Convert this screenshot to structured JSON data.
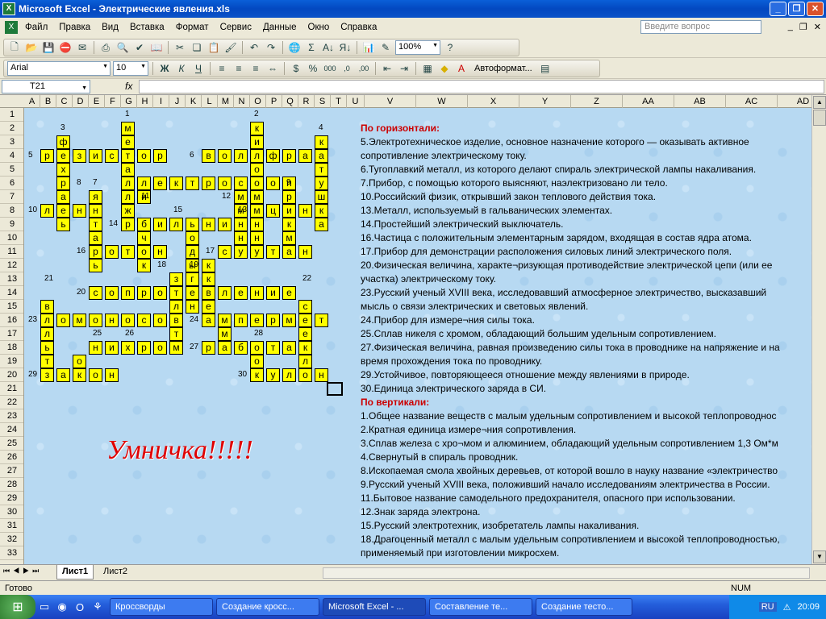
{
  "window": {
    "title": "Microsoft Excel - Электрические явления.xls"
  },
  "menu": [
    "Файл",
    "Правка",
    "Вид",
    "Вставка",
    "Формат",
    "Сервис",
    "Данные",
    "Окно",
    "Справка"
  ],
  "ask_placeholder": "Введите вопрос",
  "toolbar": {
    "zoom": "100%",
    "font": "Arial",
    "size": "10",
    "autoformat": "Автоформат..."
  },
  "namebox": "T21",
  "fx": "fx",
  "columns": [
    "A",
    "B",
    "C",
    "D",
    "E",
    "F",
    "G",
    "H",
    "I",
    "J",
    "K",
    "L",
    "M",
    "N",
    "O",
    "P",
    "Q",
    "R",
    "S",
    "T",
    "U",
    "V",
    "W",
    "X",
    "Y",
    "Z",
    "AA",
    "AB",
    "AC",
    "AD"
  ],
  "rows": [
    "1",
    "2",
    "3",
    "4",
    "5",
    "6",
    "7",
    "8",
    "9",
    "10",
    "11",
    "12",
    "13",
    "14",
    "15",
    "16",
    "17",
    "18",
    "19",
    "20",
    "21",
    "22",
    "23",
    "24",
    "25",
    "26",
    "27",
    "28",
    "29",
    "30",
    "31",
    "32",
    "33"
  ],
  "crossword": {
    "cells": [
      [
        "G2",
        "м"
      ],
      [
        "G3",
        "е"
      ],
      [
        "G4",
        "т"
      ],
      [
        "G5",
        "а"
      ],
      [
        "G6",
        "л"
      ],
      [
        "G7",
        "л"
      ],
      [
        "G8",
        "ж"
      ],
      [
        "G9",
        "р"
      ],
      [
        "O2",
        "к"
      ],
      [
        "O3",
        "и"
      ],
      [
        "O4",
        "л"
      ],
      [
        "O5",
        "о"
      ],
      [
        "O6",
        "о"
      ],
      [
        "O7",
        "м"
      ],
      [
        "O8",
        "м"
      ],
      [
        "O9",
        "н"
      ],
      [
        "O10",
        "н"
      ],
      [
        "O11",
        "у"
      ],
      [
        "S3",
        "к"
      ],
      [
        "S4",
        "а"
      ],
      [
        "S5",
        "т"
      ],
      [
        "S6",
        "у"
      ],
      [
        "S7",
        "ш"
      ],
      [
        "S8",
        "к"
      ],
      [
        "S9",
        "а"
      ],
      [
        "B4",
        "р"
      ],
      [
        "C4",
        "е"
      ],
      [
        "D4",
        "з"
      ],
      [
        "E4",
        "и"
      ],
      [
        "F4",
        "с"
      ],
      [
        "G4",
        "т"
      ],
      [
        "H4",
        "о"
      ],
      [
        "I4",
        "р"
      ],
      [
        "C3",
        "ф"
      ],
      [
        "C5",
        "х"
      ],
      [
        "C6",
        "р"
      ],
      [
        "C7",
        "а"
      ],
      [
        "C8",
        "е"
      ],
      [
        "C9",
        "ь"
      ],
      [
        "L4",
        "в"
      ],
      [
        "M4",
        "о"
      ],
      [
        "N4",
        "л"
      ],
      [
        "O4",
        "ь"
      ],
      [
        "P4",
        "ф"
      ],
      [
        "Q4",
        "р"
      ],
      [
        "R4",
        "а"
      ],
      [
        "S4",
        "м"
      ],
      [
        "G6",
        "э"
      ],
      [
        "H6",
        "л"
      ],
      [
        "I6",
        "е"
      ],
      [
        "J6",
        "к"
      ],
      [
        "K6",
        "т"
      ],
      [
        "L6",
        "р"
      ],
      [
        "M6",
        "о"
      ],
      [
        "N6",
        "с"
      ],
      [
        "O6",
        "к"
      ],
      [
        "P6",
        "о"
      ],
      [
        "Q6",
        "п"
      ],
      [
        "E7",
        "я"
      ],
      [
        "E8",
        "н"
      ],
      [
        "E9",
        "т"
      ],
      [
        "E10",
        "а"
      ],
      [
        "B8",
        "л"
      ],
      [
        "C8",
        "е"
      ],
      [
        "D8",
        "н"
      ],
      [
        "E8",
        "ц"
      ],
      [
        "H7",
        "и"
      ],
      [
        "H10",
        "ч"
      ],
      [
        "H11",
        "о"
      ],
      [
        "H12",
        "к"
      ],
      [
        "N7",
        "м"
      ],
      [
        "N8",
        "м"
      ],
      [
        "N9",
        "н"
      ],
      [
        "N10",
        "н"
      ],
      [
        "Q7",
        "р"
      ],
      [
        "Q9",
        "к"
      ],
      [
        "Q10",
        "м"
      ],
      [
        "P8",
        "ц"
      ],
      [
        "Q8",
        "и"
      ],
      [
        "R8",
        "н"
      ],
      [
        "S8",
        "к"
      ],
      [
        "G9",
        "у"
      ],
      [
        "H9",
        "б"
      ],
      [
        "I9",
        "и"
      ],
      [
        "J9",
        "л"
      ],
      [
        "K9",
        "ь"
      ],
      [
        "L9",
        "н"
      ],
      [
        "M9",
        "и"
      ],
      [
        "N9",
        "к"
      ],
      [
        "K10",
        "о"
      ],
      [
        "K11",
        "д"
      ],
      [
        "K12",
        "ы"
      ],
      [
        "K13",
        "г"
      ],
      [
        "K14",
        "е"
      ],
      [
        "K15",
        "н"
      ],
      [
        "E11",
        "р"
      ],
      [
        "F11",
        "о"
      ],
      [
        "G11",
        "т"
      ],
      [
        "H11",
        "о"
      ],
      [
        "I11",
        "н"
      ],
      [
        "M11",
        "с"
      ],
      [
        "N11",
        "у"
      ],
      [
        "O11",
        "л"
      ],
      [
        "P11",
        "т"
      ],
      [
        "Q11",
        "а"
      ],
      [
        "R11",
        "н"
      ],
      [
        "E12",
        "ь"
      ],
      [
        "L12",
        "к"
      ],
      [
        "L13",
        "к"
      ],
      [
        "J13",
        "з"
      ],
      [
        "J15",
        "л"
      ],
      [
        "J17",
        "т"
      ],
      [
        "E14",
        "с"
      ],
      [
        "F14",
        "о"
      ],
      [
        "G14",
        "п"
      ],
      [
        "H14",
        "р"
      ],
      [
        "I14",
        "о"
      ],
      [
        "J14",
        "т"
      ],
      [
        "K14",
        "и"
      ],
      [
        "L14",
        "в"
      ],
      [
        "M14",
        "л"
      ],
      [
        "N14",
        "е"
      ],
      [
        "O14",
        "н"
      ],
      [
        "P14",
        "и"
      ],
      [
        "Q14",
        "е"
      ],
      [
        "B15",
        "в"
      ],
      [
        "L15",
        "е"
      ],
      [
        "R15",
        "с"
      ],
      [
        "B16",
        "л"
      ],
      [
        "C16",
        "о"
      ],
      [
        "D16",
        "м"
      ],
      [
        "E16",
        "о"
      ],
      [
        "F16",
        "н"
      ],
      [
        "G16",
        "о"
      ],
      [
        "H16",
        "с"
      ],
      [
        "I16",
        "о"
      ],
      [
        "J16",
        "в"
      ],
      [
        "L16",
        "а"
      ],
      [
        "M16",
        "м"
      ],
      [
        "N16",
        "п"
      ],
      [
        "O16",
        "е"
      ],
      [
        "P16",
        "р"
      ],
      [
        "Q16",
        "м"
      ],
      [
        "R16",
        "е"
      ],
      [
        "S16",
        "т"
      ],
      [
        "B17",
        "л"
      ],
      [
        "M17",
        "м"
      ],
      [
        "R17",
        "е"
      ],
      [
        "E18",
        "н"
      ],
      [
        "F18",
        "и"
      ],
      [
        "G18",
        "х"
      ],
      [
        "H18",
        "р"
      ],
      [
        "I18",
        "о"
      ],
      [
        "J18",
        "м"
      ],
      [
        "L18",
        "р"
      ],
      [
        "M18",
        "а"
      ],
      [
        "N18",
        "б"
      ],
      [
        "O18",
        "о"
      ],
      [
        "P18",
        "т"
      ],
      [
        "Q18",
        "а"
      ],
      [
        "R18",
        "к"
      ],
      [
        "B18",
        "ь"
      ],
      [
        "B19",
        "т"
      ],
      [
        "D19",
        "о"
      ],
      [
        "O19",
        "о"
      ],
      [
        "R19",
        "л"
      ],
      [
        "B20",
        "з"
      ],
      [
        "C20",
        "а"
      ],
      [
        "D20",
        "к"
      ],
      [
        "E20",
        "о"
      ],
      [
        "F20",
        "н"
      ],
      [
        "O20",
        "к"
      ],
      [
        "P20",
        "у"
      ],
      [
        "Q20",
        "л"
      ],
      [
        "R20",
        "о"
      ],
      [
        "S20",
        "н"
      ]
    ],
    "numbers": [
      [
        "G1",
        "1"
      ],
      [
        "O1",
        "2"
      ],
      [
        "C2",
        "3"
      ],
      [
        "S2",
        "4"
      ],
      [
        "A4",
        "5"
      ],
      [
        "K4",
        "6"
      ],
      [
        "E6",
        "7"
      ],
      [
        "D6",
        "8"
      ],
      [
        "Q6",
        "9"
      ],
      [
        "A8",
        "10"
      ],
      [
        "H7",
        "11"
      ],
      [
        "M7",
        "12"
      ],
      [
        "N8",
        "13"
      ],
      [
        "F9",
        "14"
      ],
      [
        "J8",
        "15"
      ],
      [
        "D11",
        "16"
      ],
      [
        "L11",
        "17"
      ],
      [
        "I12",
        "18"
      ],
      [
        "K12",
        "19"
      ],
      [
        "D14",
        "20"
      ],
      [
        "B13",
        "21"
      ],
      [
        "R13",
        "22"
      ],
      [
        "A16",
        "23"
      ],
      [
        "K16",
        "24"
      ],
      [
        "E17",
        "25"
      ],
      [
        "G17",
        "26"
      ],
      [
        "K18",
        "27"
      ],
      [
        "O17",
        "28"
      ],
      [
        "A20",
        "29"
      ],
      [
        "N20",
        "30"
      ]
    ]
  },
  "clues": [
    {
      "head": true,
      "text": "По горизонтали:"
    },
    {
      "text": "5.Электротехническое изделие, основное назначение которого — оказывать активное"
    },
    {
      "text": "сопротивление электрическому току."
    },
    {
      "text": "6.Тугоплавкий металл, из которого делают спираль электрической лампы накаливания."
    },
    {
      "text": "7.Прибор, с помощью которого выясняют, наэлектризовано ли тело."
    },
    {
      "text": "10.Российский физик, открывший закон теплового действия тока."
    },
    {
      "text": "13.Металл, используемый в гальванических элементах."
    },
    {
      "text": "14.Простейший электрический выключатель."
    },
    {
      "text": "16.Частица с положительным элементарным зарядом, входящая в состав ядра атома."
    },
    {
      "text": "17.Прибор для демонстрации расположения силовых линий электрического поля."
    },
    {
      "text": "20.Физическая величина, характе¬ризующая противодействие электрической цепи (или ее"
    },
    {
      "text": "участка) электрическому току."
    },
    {
      "text": "23.Русский ученый XVIII века, исследовавший атмосферное электричество, высказавший"
    },
    {
      "text": "мысль о связи электрических и световых явлений."
    },
    {
      "text": "24.Прибор для измере¬ния силы тока."
    },
    {
      "text": "25.Сплав никеля с хромом, обладающий большим удельным сопротивлением."
    },
    {
      "text": "27.Физическая величина, равная произведению силы тока в проводнике на напряжение и на"
    },
    {
      "text": "время прохождения тока по проводнику."
    },
    {
      "text": "29.Устойчивое, повторяющееся отношение между явлениями в природе."
    },
    {
      "text": "30.Единица электрического заряда в СИ."
    },
    {
      "head": true,
      "text": "По вертикали:"
    },
    {
      "text": "1.Общее название веществ с малым удельным сопротивлением и высокой теплопроводнос"
    },
    {
      "text": "2.Кратная единица измере¬ния сопротивления."
    },
    {
      "text": "3.Сплав железа с хро¬мом и алюминием, обладающий удельным сопротивлением 1,3 Ом*м"
    },
    {
      "text": "4.Свернутый в спираль проводник."
    },
    {
      "text": "8.Ископаемая смола хвойных деревьев, от которой вошло в науку название «электричество"
    },
    {
      "text": "9.Русский ученый XVIII века, положивший начало исследованиям электричества в России."
    },
    {
      "text": "11.Бытовое название самодельного предохранителя, опасного при использовании."
    },
    {
      "text": "12.Знак заряда электрона."
    },
    {
      "text": "15.Русский электротехник, изобретатель лампы накаливания."
    },
    {
      "text": "18.Драгоценный металл с малым удельным сопротивлением и высокой теплопроводностью,"
    },
    {
      "text": "применяемый при изготовлении микросхем."
    }
  ],
  "praise": "Умничка!!!!!",
  "sheet_tabs": [
    "Лист1",
    "Лист2"
  ],
  "status": {
    "ready": "Готово",
    "num": "NUM"
  },
  "taskbar": {
    "tasks": [
      "Кроссворды",
      "Создание кросс...",
      "Microsoft Excel - ...",
      "Составление те...",
      "Создание тесто..."
    ],
    "lang": "RU",
    "clock": "20:09"
  },
  "colors": {
    "cell": "#ffff00",
    "clue_head": "#cc0000",
    "praise": "#e00000"
  }
}
